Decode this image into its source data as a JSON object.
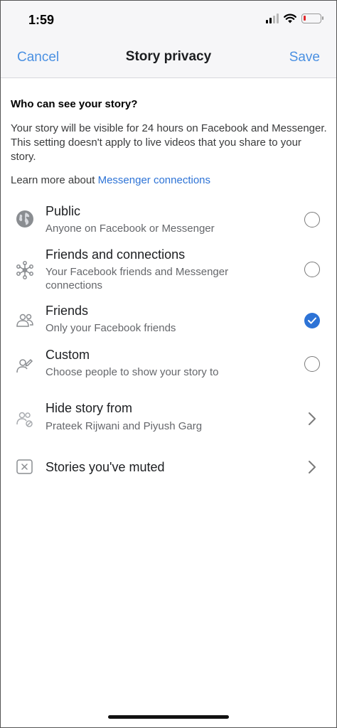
{
  "status_bar": {
    "time": "1:59"
  },
  "nav": {
    "cancel_label": "Cancel",
    "title": "Story privacy",
    "save_label": "Save"
  },
  "question": "Who can see your story?",
  "description": "Your story will be visible for 24 hours on Facebook and Messenger. This setting doesn't apply to live videos that you share to your story.",
  "learn_more": {
    "prefix": "Learn more about ",
    "link": "Messenger connections"
  },
  "options": [
    {
      "icon": "globe-icon",
      "title": "Public",
      "subtitle": "Anyone on Facebook or Messenger",
      "selected": false
    },
    {
      "icon": "network-icon",
      "title": "Friends and connections",
      "subtitle": "Your Facebook friends and Messenger connections",
      "selected": false
    },
    {
      "icon": "friends-icon",
      "title": "Friends",
      "subtitle": "Only your Facebook friends",
      "selected": true
    },
    {
      "icon": "custom-person-icon",
      "title": "Custom",
      "subtitle": "Choose people to show your story to",
      "selected": false
    }
  ],
  "hide_story": {
    "icon": "hide-people-icon",
    "title": "Hide story from",
    "subtitle": "Prateek Rijwani and Piyush Garg"
  },
  "muted": {
    "icon": "muted-box-icon",
    "title": "Stories you've muted"
  },
  "colors": {
    "accent": "#2d73d6",
    "nav_link": "#4a90e2",
    "secondary_text": "#65676b"
  }
}
